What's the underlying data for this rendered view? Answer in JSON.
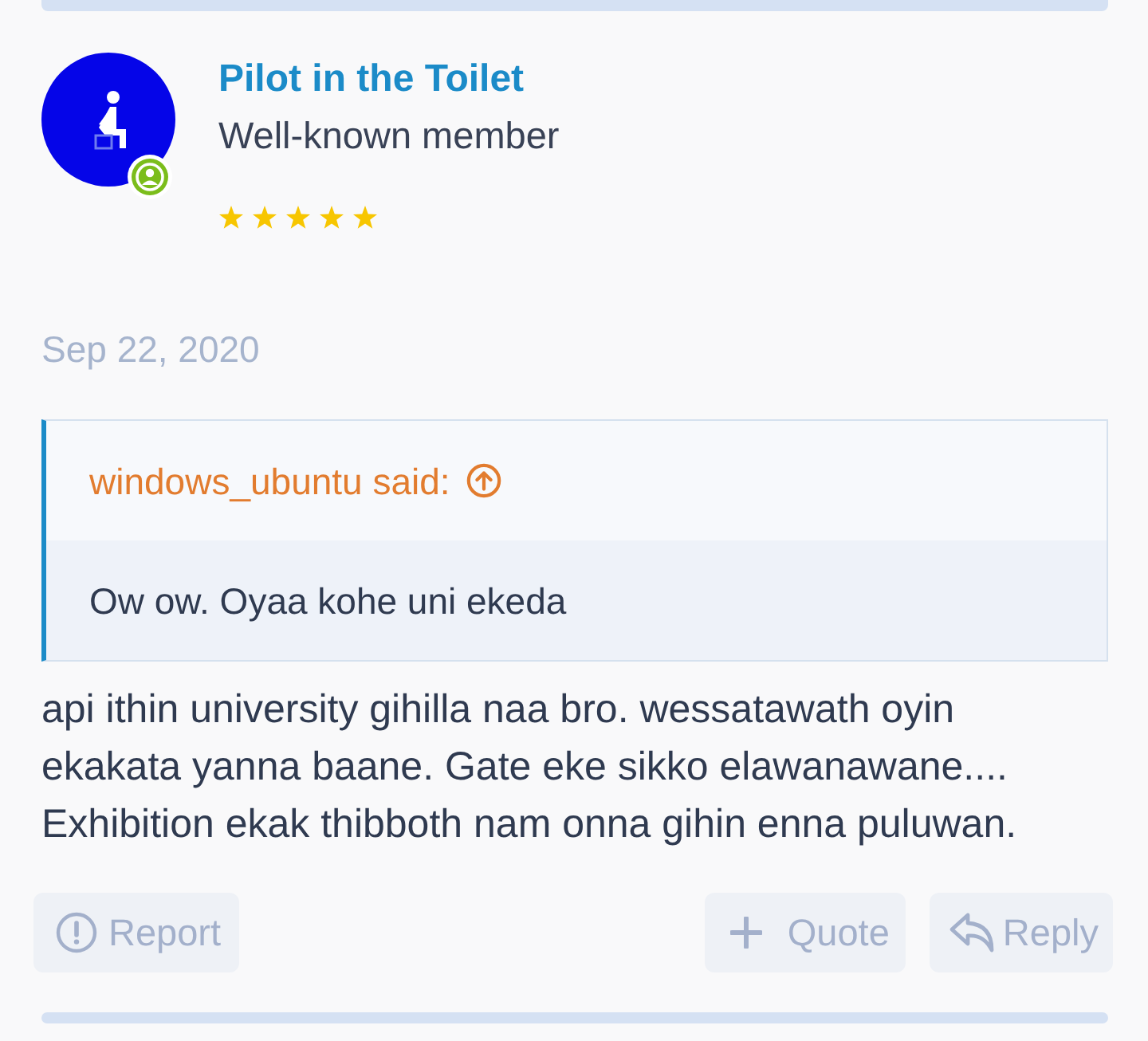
{
  "post": {
    "author": {
      "name": "Pilot in the Toilet",
      "title": "Well-known member",
      "online": true,
      "stars": 5
    },
    "date": "Sep 22, 2020",
    "quote": {
      "attribution": "windows_ubuntu said:",
      "text": "Ow ow. Oyaa kohe uni ekeda"
    },
    "body": "api ithin university gihilla naa bro. wessatawath oyin ekakata yanna baane. Gate eke sikko elawanawane.... Exhibition ekak thibboth nam onna gihin enna puluwan.",
    "actions": [
      {
        "kind": "report",
        "label": "Report"
      },
      {
        "kind": "quote",
        "label": "Quote"
      },
      {
        "kind": "reply",
        "label": "Reply"
      }
    ]
  }
}
